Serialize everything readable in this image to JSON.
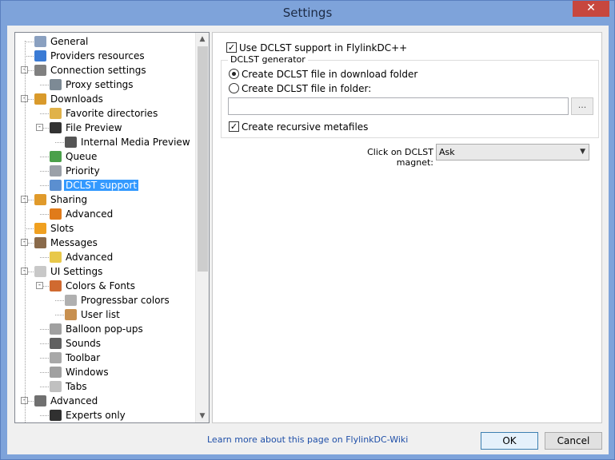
{
  "window": {
    "title": "Settings",
    "close_glyph": "✕"
  },
  "tree": {
    "items": [
      {
        "label": "General",
        "icon": "general-icon",
        "color": "#8aa0c0"
      },
      {
        "label": "Providers resources",
        "icon": "providers-icon",
        "color": "#3a7bd5"
      },
      {
        "label": "Connection settings",
        "icon": "connection-icon",
        "color": "#808080"
      },
      {
        "label": "Proxy settings",
        "icon": "proxy-icon",
        "color": "#7d8a95"
      },
      {
        "label": "Downloads",
        "icon": "downloads-icon",
        "color": "#d99a2b"
      },
      {
        "label": "Favorite directories",
        "icon": "favorite-dirs-icon",
        "color": "#e0b24a"
      },
      {
        "label": "File Preview",
        "icon": "file-preview-icon",
        "color": "#333333"
      },
      {
        "label": "Internal Media Preview",
        "icon": "media-preview-icon",
        "color": "#555555"
      },
      {
        "label": "Queue",
        "icon": "queue-icon",
        "color": "#4aa04a"
      },
      {
        "label": "Priority",
        "icon": "priority-icon",
        "color": "#9aa0a8"
      },
      {
        "label": "DCLST support",
        "icon": "dclst-icon",
        "color": "#5b8fd0"
      },
      {
        "label": "Sharing",
        "icon": "sharing-icon",
        "color": "#e09a2b"
      },
      {
        "label": "Advanced",
        "icon": "sharing-advanced-icon",
        "color": "#e07b1a"
      },
      {
        "label": "Slots",
        "icon": "slots-icon",
        "color": "#f0a020"
      },
      {
        "label": "Messages",
        "icon": "messages-icon",
        "color": "#8a6a4a"
      },
      {
        "label": "Advanced",
        "icon": "messages-advanced-icon",
        "color": "#e8c84a"
      },
      {
        "label": "UI Settings",
        "icon": "ui-settings-icon",
        "color": "#c8c8c8"
      },
      {
        "label": "Colors & Fonts",
        "icon": "colors-fonts-icon",
        "color": "#d06a30"
      },
      {
        "label": "Progressbar colors",
        "icon": "progressbar-icon",
        "color": "#b0b0b0"
      },
      {
        "label": "User list",
        "icon": "user-list-icon",
        "color": "#c89050"
      },
      {
        "label": "Balloon pop-ups",
        "icon": "balloon-icon",
        "color": "#a0a0a0"
      },
      {
        "label": "Sounds",
        "icon": "sounds-icon",
        "color": "#606060"
      },
      {
        "label": "Toolbar",
        "icon": "toolbar-icon",
        "color": "#a8a8a8"
      },
      {
        "label": "Windows",
        "icon": "windows-icon",
        "color": "#a0a0a0"
      },
      {
        "label": "Tabs",
        "icon": "tabs-icon",
        "color": "#c0c0c0"
      },
      {
        "label": "Advanced",
        "icon": "tools-icon",
        "color": "#707070"
      },
      {
        "label": "Experts only",
        "icon": "experts-icon",
        "color": "#303030"
      }
    ],
    "selected_label": "DCLST support"
  },
  "panel": {
    "use_dclst_label": "Use DCLST support in FlylinkDC++",
    "use_dclst_checked": true,
    "group_title": "DCLST generator",
    "radio_download_folder_label": "Create DCLST file in download folder",
    "radio_folder_label": "Create DCLST file in folder:",
    "selected_radio": "download_folder",
    "folder_path_value": "",
    "browse_label": "...",
    "recursive_label": "Create recursive metafiles",
    "recursive_checked": true,
    "magnet_label": "Click on DCLST magnet:",
    "magnet_value": "Ask"
  },
  "footer": {
    "link_text": "Learn more about this page on FlylinkDC-Wiki",
    "ok_label": "OK",
    "cancel_label": "Cancel"
  }
}
